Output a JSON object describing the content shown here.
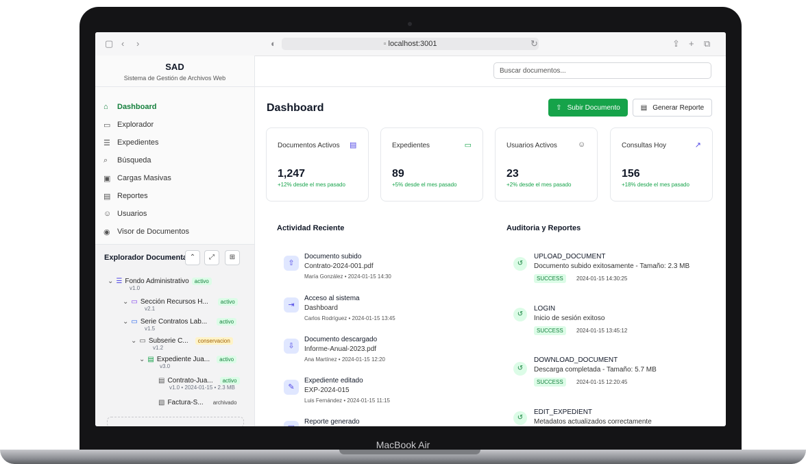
{
  "device": {
    "label": "MacBook Air"
  },
  "browser": {
    "url": "localhost:3001"
  },
  "sidebar": {
    "app_title": "SAD",
    "app_subtitle": "Sistema de Gestión de Archivos Web",
    "nav": [
      {
        "label": "Dashboard",
        "icon": "home-icon",
        "active": true
      },
      {
        "label": "Explorador",
        "icon": "folder-icon"
      },
      {
        "label": "Expedientes",
        "icon": "database-icon"
      },
      {
        "label": "Búsqueda",
        "icon": "search-icon"
      },
      {
        "label": "Cargas Masivas",
        "icon": "upload-file-icon"
      },
      {
        "label": "Reportes",
        "icon": "report-icon"
      },
      {
        "label": "Usuarios",
        "icon": "users-icon"
      },
      {
        "label": "Visor de Documentos",
        "icon": "eye-icon"
      }
    ],
    "explorer": {
      "title": "Explorador Documental",
      "tree": [
        {
          "name": "Fondo Administrativo",
          "badge": "activo",
          "sub": "v1.0"
        },
        {
          "name": "Sección Recursos H...",
          "badge": "activo",
          "sub": "v2.1"
        },
        {
          "name": "Serie Contratos Lab...",
          "badge": "activo",
          "sub": "v1.5"
        },
        {
          "name": "Subserie C...",
          "badge": "conservacion",
          "sub": "v1.2"
        },
        {
          "name": "Expediente Jua...",
          "badge": "activo",
          "sub": "v3.0"
        },
        {
          "name": "Contrato-Jua...",
          "badge": "activo",
          "sub": "v1.0 • 2024-01-15 • 2.3 MB"
        },
        {
          "name": "Factura-S...",
          "badge": "archivado",
          "sub": ""
        }
      ]
    }
  },
  "header": {
    "search_placeholder": "Buscar documentos..."
  },
  "main": {
    "title": "Dashboard",
    "upload_label": "Subir Documento",
    "report_label": "Generar Reporte",
    "stats": [
      {
        "title": "Documentos Activos",
        "value": "1,247",
        "delta": "+12% desde el mes pasado",
        "icon": "document-icon"
      },
      {
        "title": "Expedientes",
        "value": "89",
        "delta": "+5% desde el mes pasado",
        "icon": "folder-icon"
      },
      {
        "title": "Usuarios Activos",
        "value": "23",
        "delta": "+2% desde el mes pasado",
        "icon": "users-icon"
      },
      {
        "title": "Consultas Hoy",
        "value": "156",
        "delta": "+18% desde el mes pasado",
        "icon": "trending-up-icon"
      }
    ],
    "activity_title": "Actividad Reciente",
    "activity": [
      {
        "title": "Documento subido",
        "file": "Contrato-2024-001.pdf",
        "user": "María González",
        "time": "2024-01-15 14:30"
      },
      {
        "title": "Acceso al sistema",
        "file": "Dashboard",
        "user": "Carlos Rodríguez",
        "time": "2024-01-15 13:45"
      },
      {
        "title": "Documento descargado",
        "file": "Informe-Anual-2023.pdf",
        "user": "Ana Martínez",
        "time": "2024-01-15 12:20"
      },
      {
        "title": "Expediente editado",
        "file": "EXP-2024-015",
        "user": "Luis Fernández",
        "time": "2024-01-15 11:15"
      },
      {
        "title": "Reporte generado",
        "file": "",
        "user": "",
        "time": ""
      }
    ],
    "audit_title": "Auditoria y Reportes",
    "audit": [
      {
        "action": "UPLOAD_DOCUMENT",
        "desc": "Documento subido exitosamente - Tamaño: 2.3 MB",
        "status": "SUCCESS",
        "time": "2024-01-15 14:30:25"
      },
      {
        "action": "LOGIN",
        "desc": "Inicio de sesión exitoso",
        "status": "SUCCESS",
        "time": "2024-01-15 13:45:12"
      },
      {
        "action": "DOWNLOAD_DOCUMENT",
        "desc": "Descarga completada - Tamaño: 5.7 MB",
        "status": "SUCCESS",
        "time": "2024-01-15 12:20:45"
      },
      {
        "action": "EDIT_EXPEDIENT",
        "desc": "Metadatos actualizados correctamente",
        "status": "",
        "time": ""
      }
    ]
  },
  "colors": {
    "accent": "#16a34a",
    "accent_text": "#15803d"
  }
}
